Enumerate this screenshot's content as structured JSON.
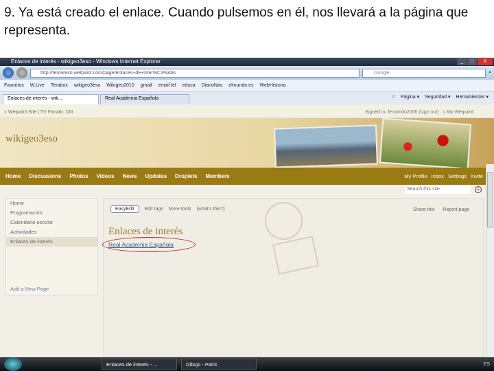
{
  "caption": "9. Ya está creado el enlace. Cuando pulsemos en él, nos llevará a la página que representa.",
  "browser": {
    "title": "Enlaces de interés - wikigeo3eso - Windows Internet Explorer",
    "url": "http://tercereso.wetpaint.com/page/Enlaces+de+inter%C3%A9s",
    "search_placeholder": "Google",
    "favorites": [
      "Favoritos",
      "W.Live",
      "Terabox",
      "wikigeo3eso",
      "Wikigeo2010",
      "gmail",
      "email tel",
      "educa",
      "DiarioNav",
      "elmundo.es",
      "WebHistoria"
    ],
    "tabs": [
      {
        "label": "Enlaces de interés - wik...",
        "active": true
      },
      {
        "label": "Real Academia Española",
        "active": false
      }
    ],
    "commands": [
      "Página ▾",
      "Seguridad ▾",
      "Herramientas ▾"
    ]
  },
  "site": {
    "wetpaint_bar": "« Wetpaint Site | TV Fanatic 100",
    "signed_in": "Signed in: fernando2006 (sign out)",
    "my_wetpaint": "» My Wetpaint",
    "logo": "wikigeo3eso",
    "nav": [
      "Home",
      "Discussions",
      "Photos",
      "Videos",
      "News",
      "Updates",
      "Droplets",
      "Members"
    ],
    "user_nav": [
      "My Profile",
      "Inbox",
      "Settings",
      "Invite"
    ],
    "search_placeholder": "Search this site",
    "sidebar": [
      "Home",
      "Programación",
      "Calendario escolar",
      "Actividades",
      "Enlaces de interés"
    ],
    "add_page": "Add a New Page",
    "toolbar": {
      "easyedit": "EasyEdit",
      "edit_tags": "Edit tags",
      "more_tools": "More tools",
      "whats_this": "(what's this?)",
      "share": "Share this",
      "report": "Report page"
    },
    "page_title": "Enlaces de interés",
    "link": "Real Academia Española"
  },
  "taskbar": {
    "items": [
      "Enlaces de interés - ...",
      "Dibujo - Paint"
    ],
    "lang": "ES"
  }
}
